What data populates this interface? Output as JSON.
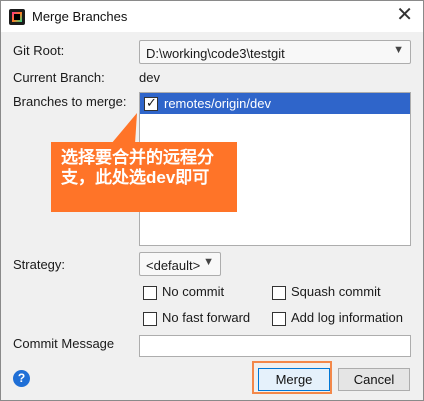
{
  "window": {
    "title": "Merge Branches",
    "close_glyph": "✕"
  },
  "git_root": {
    "label": "Git Root:",
    "value": "D:\\working\\code3\\testgit"
  },
  "current_branch": {
    "label": "Current Branch:",
    "value": "dev"
  },
  "branches": {
    "label": "Branches to merge:",
    "items": [
      {
        "name": "remotes/origin/dev",
        "checked": true
      }
    ]
  },
  "callout": {
    "text": "选择要合并的远程分支，此处选dev即可"
  },
  "strategy": {
    "label": "Strategy:",
    "value": "<default>"
  },
  "options": {
    "no_commit": "No commit",
    "squash_commit": "Squash commit",
    "no_fast_forward": "No fast forward",
    "add_log": "Add log information"
  },
  "commit_message": {
    "label": "Commit Message",
    "value": ""
  },
  "buttons": {
    "help": "?",
    "merge": "Merge",
    "cancel": "Cancel"
  }
}
